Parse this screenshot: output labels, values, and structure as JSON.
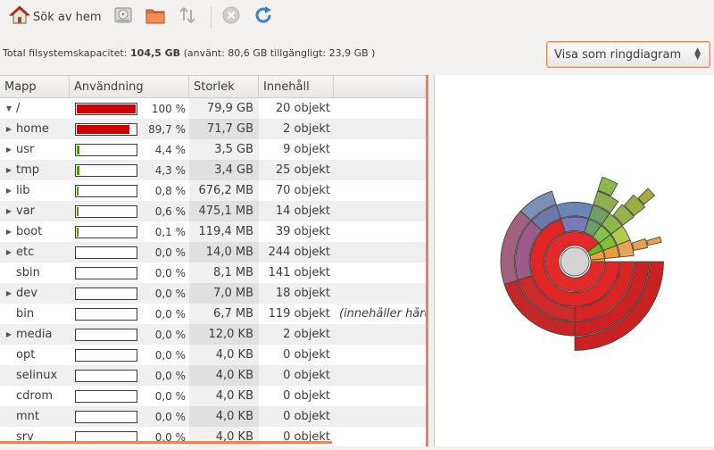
{
  "toolbar": {
    "scan_home_label": "Sök av hem",
    "items": [
      {
        "name": "scan-home",
        "icon": "home-icon"
      },
      {
        "name": "scan-filesystem",
        "icon": "harddisk-icon"
      },
      {
        "name": "scan-folder",
        "icon": "folder-icon"
      },
      {
        "name": "scan-remote",
        "icon": "transfer-icon"
      },
      {
        "name": "stop",
        "icon": "stop-icon"
      },
      {
        "name": "refresh",
        "icon": "refresh-icon"
      }
    ]
  },
  "info": {
    "prefix": "Total filsystemskapacitet:",
    "capacity": "104,5 GB",
    "details": "(använt: 80,6 GB tillgängligt: 23,9 GB )"
  },
  "view_selector": {
    "label": "Visa som ringdiagram"
  },
  "tree": {
    "columns": [
      "Mapp",
      "Användning",
      "Storlek",
      "Innehåll"
    ],
    "rows": [
      {
        "name": "/",
        "expander": "open",
        "usage": 1.0,
        "usage_label": "100 %",
        "bar_color": "#cc0000",
        "size": "79,9 GB",
        "content": "20 objekt",
        "extra": ""
      },
      {
        "name": "home",
        "expander": "closed",
        "usage": 0.897,
        "usage_label": "89,7 %",
        "bar_color": "#cc0000",
        "size": "71,7 GB",
        "content": "2 objekt",
        "extra": ""
      },
      {
        "name": "usr",
        "expander": "closed",
        "usage": 0.044,
        "usage_label": "4,4 %",
        "bar_color": "#4e9a06",
        "size": "3,5 GB",
        "content": "9 objekt",
        "extra": ""
      },
      {
        "name": "tmp",
        "expander": "closed",
        "usage": 0.043,
        "usage_label": "4,3 %",
        "bar_color": "#4e9a06",
        "size": "3,4 GB",
        "content": "25 objekt",
        "extra": ""
      },
      {
        "name": "lib",
        "expander": "closed",
        "usage": 0.008,
        "usage_label": "0,8 %",
        "bar_color": "#4e9a06",
        "size": "676,2 MB",
        "content": "70 objekt",
        "extra": ""
      },
      {
        "name": "var",
        "expander": "closed",
        "usage": 0.006,
        "usage_label": "0,6 %",
        "bar_color": "#4e9a06",
        "size": "475,1 MB",
        "content": "14 objekt",
        "extra": ""
      },
      {
        "name": "boot",
        "expander": "closed",
        "usage": 0.001,
        "usage_label": "0,1 %",
        "bar_color": "#4e9a06",
        "size": "119,4 MB",
        "content": "39 objekt",
        "extra": ""
      },
      {
        "name": "etc",
        "expander": "closed",
        "usage": 0.0,
        "usage_label": "0,0 %",
        "bar_color": "#4e9a06",
        "size": "14,0 MB",
        "content": "244 objekt",
        "extra": ""
      },
      {
        "name": "sbin",
        "expander": "none",
        "usage": 0.0,
        "usage_label": "0,0 %",
        "bar_color": "#4e9a06",
        "size": "8,1 MB",
        "content": "141 objekt",
        "extra": ""
      },
      {
        "name": "dev",
        "expander": "closed",
        "usage": 0.0,
        "usage_label": "0,0 %",
        "bar_color": "#4e9a06",
        "size": "7,0 MB",
        "content": "18 objekt",
        "extra": ""
      },
      {
        "name": "bin",
        "expander": "none",
        "usage": 0.0,
        "usage_label": "0,0 %",
        "bar_color": "#4e9a06",
        "size": "6,7 MB",
        "content": "119 objekt",
        "extra": "(innehåller hård"
      },
      {
        "name": "media",
        "expander": "closed",
        "usage": 0.0,
        "usage_label": "0,0 %",
        "bar_color": "#4e9a06",
        "size": "12,0 KB",
        "content": "2 objekt",
        "extra": ""
      },
      {
        "name": "opt",
        "expander": "none",
        "usage": 0.0,
        "usage_label": "0,0 %",
        "bar_color": "#4e9a06",
        "size": "4,0 KB",
        "content": "0 objekt",
        "extra": ""
      },
      {
        "name": "selinux",
        "expander": "none",
        "usage": 0.0,
        "usage_label": "0,0 %",
        "bar_color": "#4e9a06",
        "size": "4,0 KB",
        "content": "0 objekt",
        "extra": ""
      },
      {
        "name": "cdrom",
        "expander": "none",
        "usage": 0.0,
        "usage_label": "0,0 %",
        "bar_color": "#4e9a06",
        "size": "4,0 KB",
        "content": "0 objekt",
        "extra": ""
      },
      {
        "name": "mnt",
        "expander": "none",
        "usage": 0.0,
        "usage_label": "0,0 %",
        "bar_color": "#4e9a06",
        "size": "4,0 KB",
        "content": "0 objekt",
        "extra": ""
      },
      {
        "name": "srv",
        "expander": "none",
        "usage": 0.0,
        "usage_label": "0,0 %",
        "bar_color": "#4e9a06",
        "size": "4,0 KB",
        "content": "0 objekt",
        "extra": ""
      }
    ]
  },
  "ring_chart": {
    "center_color": "#d3d3d3",
    "segments": [
      {
        "ring": 1,
        "start": 0.0,
        "end": 0.897,
        "color": "#e32a2a"
      },
      {
        "ring": 1,
        "start": 0.897,
        "end": 0.941,
        "color": "#6fb52c"
      },
      {
        "ring": 1,
        "start": 0.941,
        "end": 0.984,
        "color": "#f0a33c"
      },
      {
        "ring": 1,
        "start": 0.984,
        "end": 1.0,
        "color": "#f0a33c"
      },
      {
        "ring": 2,
        "start": 0.0,
        "end": 0.7,
        "color": "#e12525"
      },
      {
        "ring": 2,
        "start": 0.7,
        "end": 0.8,
        "color": "#7b79b8"
      },
      {
        "ring": 2,
        "start": 0.8,
        "end": 0.85,
        "color": "#6aa067"
      },
      {
        "ring": 2,
        "start": 0.85,
        "end": 0.897,
        "color": "#88c24a"
      },
      {
        "ring": 2,
        "start": 0.897,
        "end": 0.941,
        "color": "#7cc33b"
      },
      {
        "ring": 2,
        "start": 0.941,
        "end": 0.984,
        "color": "#eb9a3c"
      },
      {
        "ring": 3,
        "start": 0.0,
        "end": 0.25,
        "color": "#d92424"
      },
      {
        "ring": 3,
        "start": 0.25,
        "end": 0.45,
        "color": "#cf2a2a"
      },
      {
        "ring": 3,
        "start": 0.45,
        "end": 0.62,
        "color": "#9b5c8a"
      },
      {
        "ring": 3,
        "start": 0.62,
        "end": 0.7,
        "color": "#6c78a8"
      },
      {
        "ring": 3,
        "start": 0.7,
        "end": 0.8,
        "color": "#6a86b8"
      },
      {
        "ring": 3,
        "start": 0.8,
        "end": 0.85,
        "color": "#6f9f63"
      },
      {
        "ring": 3,
        "start": 0.85,
        "end": 0.897,
        "color": "#8ab848"
      },
      {
        "ring": 3,
        "start": 0.897,
        "end": 0.941,
        "color": "#b5c94b"
      },
      {
        "ring": 3,
        "start": 0.941,
        "end": 0.984,
        "color": "#e6a45a"
      },
      {
        "ring": 4,
        "start": 0.0,
        "end": 0.25,
        "color": "#cc2222"
      },
      {
        "ring": 4,
        "start": 0.25,
        "end": 0.45,
        "color": "#c42727"
      },
      {
        "ring": 4,
        "start": 0.45,
        "end": 0.62,
        "color": "#a0607e"
      },
      {
        "ring": 4,
        "start": 0.62,
        "end": 0.7,
        "color": "#7d8fb5"
      },
      {
        "ring": 4,
        "start": 0.8,
        "end": 0.85,
        "color": "#8fae52"
      },
      {
        "ring": 4,
        "start": 0.86,
        "end": 0.897,
        "color": "#98b34c"
      },
      {
        "ring": 4,
        "start": 0.95,
        "end": 0.97,
        "color": "#e8a050"
      },
      {
        "ring": 5,
        "start": 0.0,
        "end": 0.25,
        "color": "#c92222"
      },
      {
        "ring": 5,
        "start": 0.8,
        "end": 0.83,
        "color": "#86b84a"
      },
      {
        "ring": 5,
        "start": 0.865,
        "end": 0.895,
        "color": "#9aae42"
      },
      {
        "ring": 5,
        "start": 0.955,
        "end": 0.965,
        "color": "#eca24a"
      },
      {
        "ring": 6,
        "start": 0.875,
        "end": 0.89,
        "color": "#a6ad3c"
      }
    ]
  }
}
